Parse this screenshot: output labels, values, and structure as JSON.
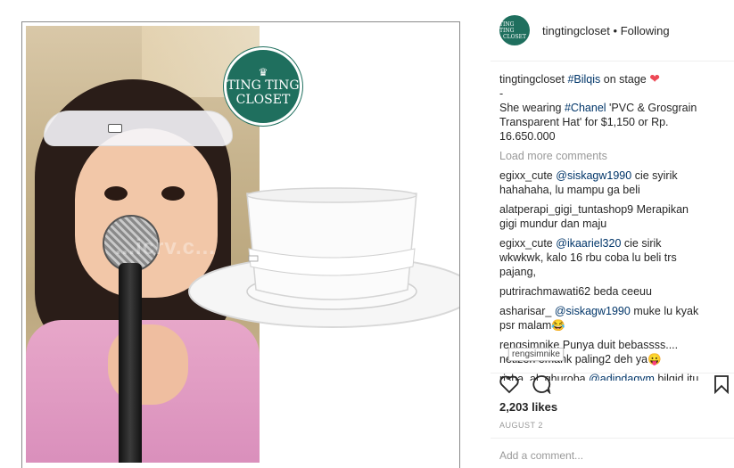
{
  "logo": {
    "line1": "TING TING",
    "line2": "CLOSET",
    "avatar_line1": "TING TING",
    "avatar_line2": "CLOSET"
  },
  "photo": {
    "watermark": "...icrv.c..."
  },
  "header": {
    "username": "tingtingcloset",
    "separator": "•",
    "follow_state": "Following"
  },
  "caption": {
    "username": "tingtingcloset",
    "hashtag": "#Bilqis",
    "text1": "on stage",
    "dash": "-",
    "text2_prefix": "She wearing",
    "hashtag2": "#Chanel",
    "text2_rest": "'PVC & Grosgrain Transparent Hat' for $1,150 or Rp. 16.650.000"
  },
  "load_more": "Load more comments",
  "comments": [
    {
      "user": "egixx_cute",
      "mention": "@siskagw1990",
      "text": "cie syirik hahahaha, lu mampu ga beli"
    },
    {
      "user": "alatperapi_gigi_tuntashop9",
      "mention": "",
      "text": "Merapikan gigi mundur dan maju"
    },
    {
      "user": "egixx_cute",
      "mention": "@ikaariel320",
      "text": "cie sirik wkwkwk, kalo 16 rbu coba lu beli trs pajang,"
    },
    {
      "user": "putrirachmawati62",
      "mention": "",
      "text": "beda ceeuu"
    },
    {
      "user": "asharisar_",
      "mention": "@siskagw1990",
      "text": "muke lu kyak psr malam😂"
    },
    {
      "user": "rengsimnike",
      "mention": "",
      "text": "Punya duit bebassss.... netizen emank paling2 deh ya😛"
    },
    {
      "user": "risha_al_ghuroba",
      "mention": "@adindagym",
      "text": "bilqid itu"
    }
  ],
  "tooltip": "rengsimnike",
  "likes": "2,203 likes",
  "date": "AUGUST 2",
  "add_comment_placeholder": "Add a comment..."
}
